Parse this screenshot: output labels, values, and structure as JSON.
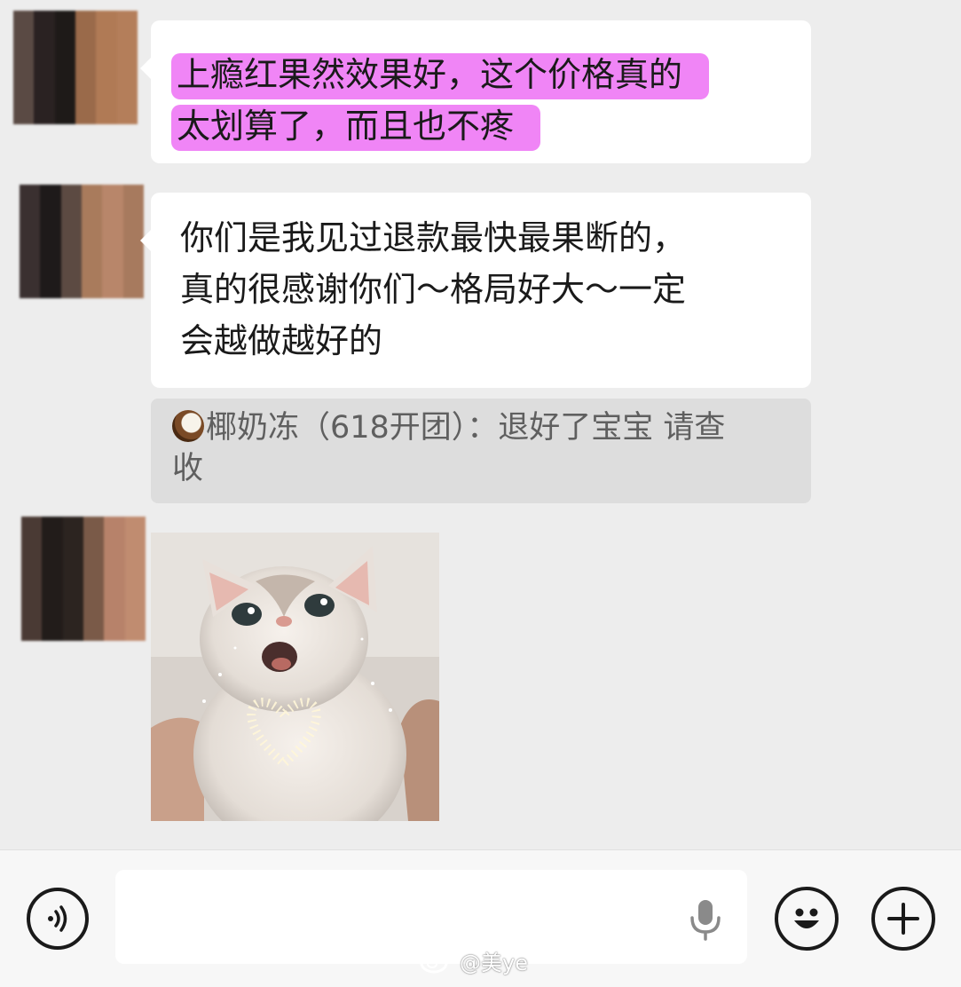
{
  "messages": [
    {
      "line1": "上瘾红果然效果好，这个价格真的",
      "line2": "太划算了，而且也不疼"
    },
    {
      "line1": "你们是我见过退款最快最果断的，",
      "line2": "真的很感谢你们～格局好大～一定",
      "line3": "会越做越好的"
    }
  ],
  "quote": {
    "line1": "椰奶冻（618开团）：退好了宝宝 请查",
    "line2": "收"
  },
  "watermark": "@美ye",
  "colors": {
    "highlight": "#f085f6",
    "background": "#ededed",
    "bubble": "#ffffff",
    "quote_bg": "#dddddd"
  },
  "icons": {
    "voice": "voice-icon",
    "mic": "mic-icon",
    "emoji": "emoji-icon",
    "plus": "plus-icon",
    "coconut": "coconut-emoji"
  }
}
